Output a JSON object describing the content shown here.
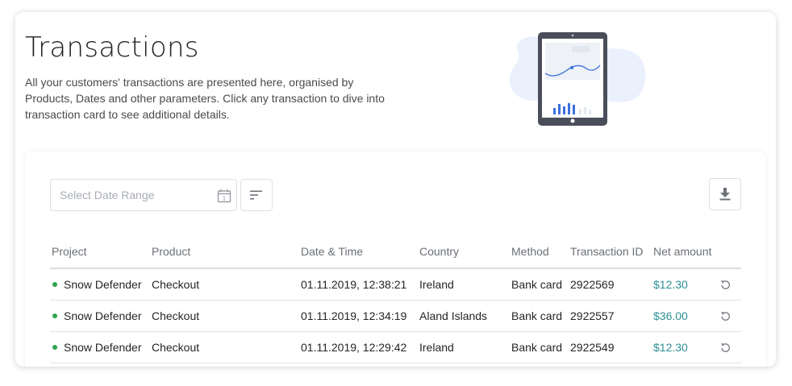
{
  "header": {
    "title": "Transactions",
    "description": "All your customers' transactions are presented here, organised by Products, Dates and other parameters. Click any transaction to dive into transaction card to see additional details."
  },
  "toolbar": {
    "date_range_placeholder": "Select Date Range",
    "calendar_icon_number": "1"
  },
  "icons": {
    "calendar": "calendar-icon",
    "filter": "sort-lines-icon",
    "download": "download-icon",
    "refund": "refund-icon",
    "status": "status-dot"
  },
  "colors": {
    "accent_amount": "#2c8f96",
    "status_active": "#2ea44f",
    "illustration_bars": "#3b6fe0",
    "illustration_blob": "#eaf0fc",
    "tablet_frame": "#4a4d5a"
  },
  "table": {
    "columns": [
      "Project",
      "Product",
      "Date & Time",
      "Country",
      "Method",
      "Transaction ID",
      "Net amount"
    ],
    "rows": [
      {
        "project": "Snow Defender",
        "product": "Checkout",
        "datetime": "01.11.2019, 12:38:21",
        "country": "Ireland",
        "method": "Bank card",
        "transaction_id": "2922569",
        "net_amount": "$12.30"
      },
      {
        "project": "Snow Defender",
        "product": "Checkout",
        "datetime": "01.11.2019, 12:34:19",
        "country": "Aland Islands",
        "method": "Bank card",
        "transaction_id": "2922557",
        "net_amount": "$36.00"
      },
      {
        "project": "Snow Defender",
        "product": "Checkout",
        "datetime": "01.11.2019, 12:29:42",
        "country": "Ireland",
        "method": "Bank card",
        "transaction_id": "2922549",
        "net_amount": "$12.30"
      }
    ]
  }
}
